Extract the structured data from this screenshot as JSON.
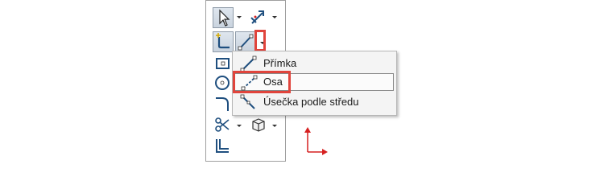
{
  "colors": {
    "highlight": "#e0443c",
    "icon_blue": "#1f4f7f",
    "axis_red": "#d62020"
  },
  "toolbar": {
    "icons": [
      "select-arrow-icon",
      "smart-dimension-icon",
      "sketch-icon",
      "line-icon",
      "rectangle-icon",
      "circle-icon",
      "fillet-icon",
      "trim-icon",
      "3d-sketch-icon",
      "offset-icon"
    ]
  },
  "flyout": {
    "items": [
      {
        "label": "Přímka",
        "icon": "line-icon"
      },
      {
        "label": "Osa",
        "icon": "centerline-icon"
      },
      {
        "label": "Úsečka podle středu",
        "icon": "midpoint-line-icon"
      }
    ]
  }
}
